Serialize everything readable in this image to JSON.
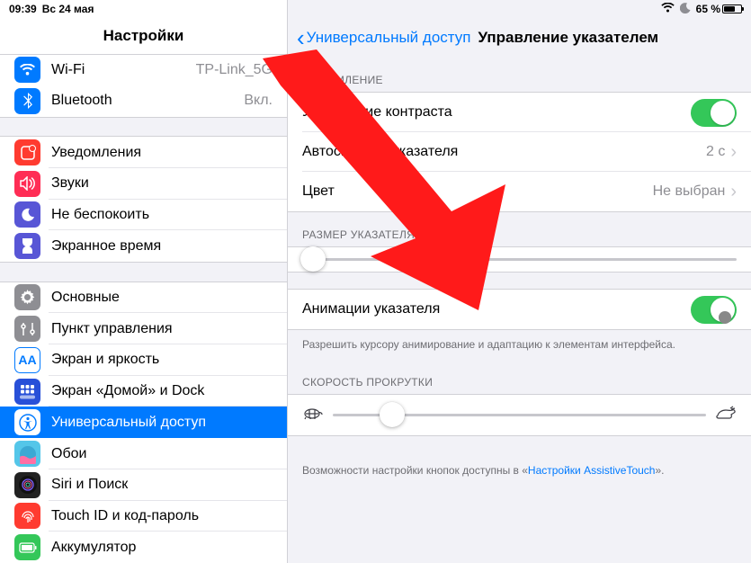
{
  "status": {
    "time": "09:39",
    "date": "Вс 24 мая",
    "battery": "65 %"
  },
  "sidebar": {
    "title": "Настройки",
    "wifi": {
      "label": "Wi-Fi",
      "value": "TP-Link_5G"
    },
    "bt": {
      "label": "Bluetooth",
      "value": "Вкл."
    },
    "notif": "Уведомления",
    "sound": "Звуки",
    "dnd": "Не беспокоить",
    "time": "Экранное время",
    "general": "Основные",
    "cc": "Пункт управления",
    "display": "Экран и яркость",
    "home": "Экран «Домой» и Dock",
    "accessibility": "Универсальный доступ",
    "wallpaper": "Обои",
    "siri": "Siri и Поиск",
    "touchid": "Touch ID и код-пароль",
    "battery": "Аккумулятор"
  },
  "detail": {
    "back": "Универсальный доступ",
    "title": "Управление указателем",
    "section_appearance": "ОФОРМЛЕНИЕ",
    "contrast": "Увеличение контраста",
    "autohide": {
      "label": "Автоскрытие указателя",
      "value": "2 с"
    },
    "color": {
      "label": "Цвет",
      "value": "Не выбран"
    },
    "section_size": "РАЗМЕР УКАЗАТЕЛЯ",
    "animations": "Анимации указателя",
    "animations_footer": "Разрешить курсору анимирование и адаптацию к элементам интерфейса.",
    "section_scroll": "СКОРОСТЬ ПРОКРУТКИ",
    "footer_pre": "Возможности настройки кнопок доступны в «",
    "footer_link": "Настройки AssistiveTouch",
    "footer_post": "»."
  },
  "icons": {
    "wifi": "wifi",
    "bt": "bluetooth",
    "notif": "notifications",
    "sound": "sound",
    "dnd": "dnd",
    "time": "screentime",
    "gen": "general",
    "cc": "control-center",
    "disp": "display",
    "home": "home",
    "acc": "accessibility",
    "wall": "wallpaper",
    "siri": "siri",
    "touch": "touchid",
    "batt": "battery"
  }
}
